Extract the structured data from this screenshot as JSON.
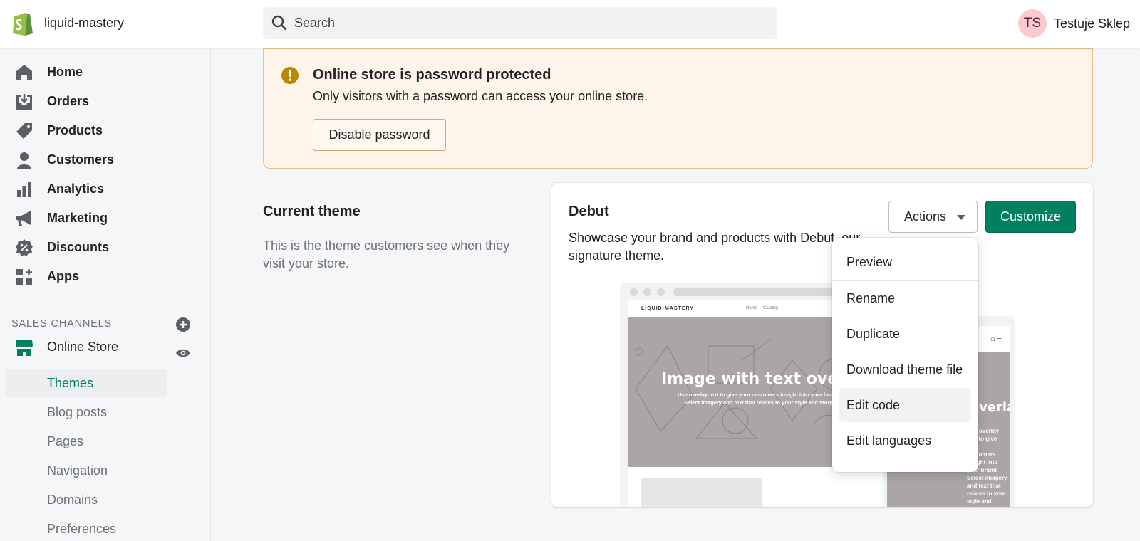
{
  "header": {
    "store_name": "liquid-mastery",
    "search": {
      "placeholder": "Search"
    },
    "user": {
      "initials": "TS",
      "name": "Testuje Sklep"
    }
  },
  "sidebar": {
    "items": [
      {
        "label": "Home",
        "icon": "home-icon"
      },
      {
        "label": "Orders",
        "icon": "orders-icon"
      },
      {
        "label": "Products",
        "icon": "tag-icon"
      },
      {
        "label": "Customers",
        "icon": "person-icon"
      },
      {
        "label": "Analytics",
        "icon": "bar-chart-icon"
      },
      {
        "label": "Marketing",
        "icon": "megaphone-icon"
      },
      {
        "label": "Discounts",
        "icon": "discount-icon"
      },
      {
        "label": "Apps",
        "icon": "apps-icon"
      }
    ],
    "sales_channels_title": "SALES CHANNELS",
    "online_store": {
      "label": "Online Store",
      "icon": "store-icon"
    },
    "sub_items": [
      {
        "label": "Themes",
        "active": true
      },
      {
        "label": "Blog posts"
      },
      {
        "label": "Pages"
      },
      {
        "label": "Navigation"
      },
      {
        "label": "Domains"
      },
      {
        "label": "Preferences"
      }
    ]
  },
  "banner": {
    "title": "Online store is password protected",
    "text": "Only visitors with a password can access your online store.",
    "button": "Disable password"
  },
  "current_theme": {
    "title": "Current theme",
    "description": "This is the theme customers see when they visit your store.",
    "theme_name": "Debut",
    "theme_description": "Showcase your brand and products with Debut, our signature theme.",
    "actions_label": "Actions",
    "customize_label": "Customize",
    "preview": {
      "brand": "LIQUID-MASTERY",
      "nav": [
        "Home",
        "Catalog"
      ],
      "hero_title": "Image with text overlay",
      "hero_text": "Use overlay text to give your customers insight into your brand. Select imagery and text that relates to your style and story.",
      "mobile_title": "Image with text overlay",
      "mobile_text": "Use overlay text to give your customers insight into your brand. Select imagery and text that relates to your style and story."
    }
  },
  "actions_menu": {
    "items": [
      "Preview",
      "Rename",
      "Duplicate",
      "Download theme file",
      "Edit code",
      "Edit languages"
    ],
    "hovered": "Edit code"
  },
  "colors": {
    "accent": "#008060",
    "banner_bg": "#fff4ea",
    "warning_icon": "#b98900",
    "logo_green": "#95bf47"
  }
}
